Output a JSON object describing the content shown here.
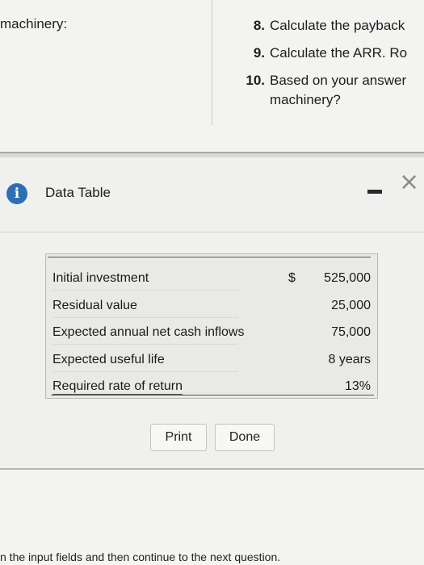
{
  "question_area": {
    "left_text": "machinery:",
    "questions": [
      {
        "num": "8.",
        "text": "Calculate the payback"
      },
      {
        "num": "9.",
        "text": "Calculate the ARR. Ro"
      },
      {
        "num": "10.",
        "text": "Based on your answer"
      }
    ],
    "q10_continuation": "machinery?"
  },
  "dialog": {
    "title": "Data Table",
    "info_icon_glyph": "i",
    "close_glyph": "×",
    "table": {
      "currency_symbol": "$",
      "rows": [
        {
          "label": "Initial investment",
          "value": "525,000"
        },
        {
          "label": "Residual value",
          "value": "25,000"
        },
        {
          "label": "Expected annual net cash inflows",
          "value": "75,000"
        },
        {
          "label": "Expected useful life",
          "value": "8 years"
        },
        {
          "label": "Required rate of return",
          "value": "13%"
        }
      ]
    },
    "buttons": {
      "print": "Print",
      "done": "Done"
    }
  },
  "footer": {
    "instruction": "n the input fields and then continue to the next question."
  },
  "colors": {
    "info_icon": "#2c6fb6",
    "background": "#f0f0ee"
  }
}
